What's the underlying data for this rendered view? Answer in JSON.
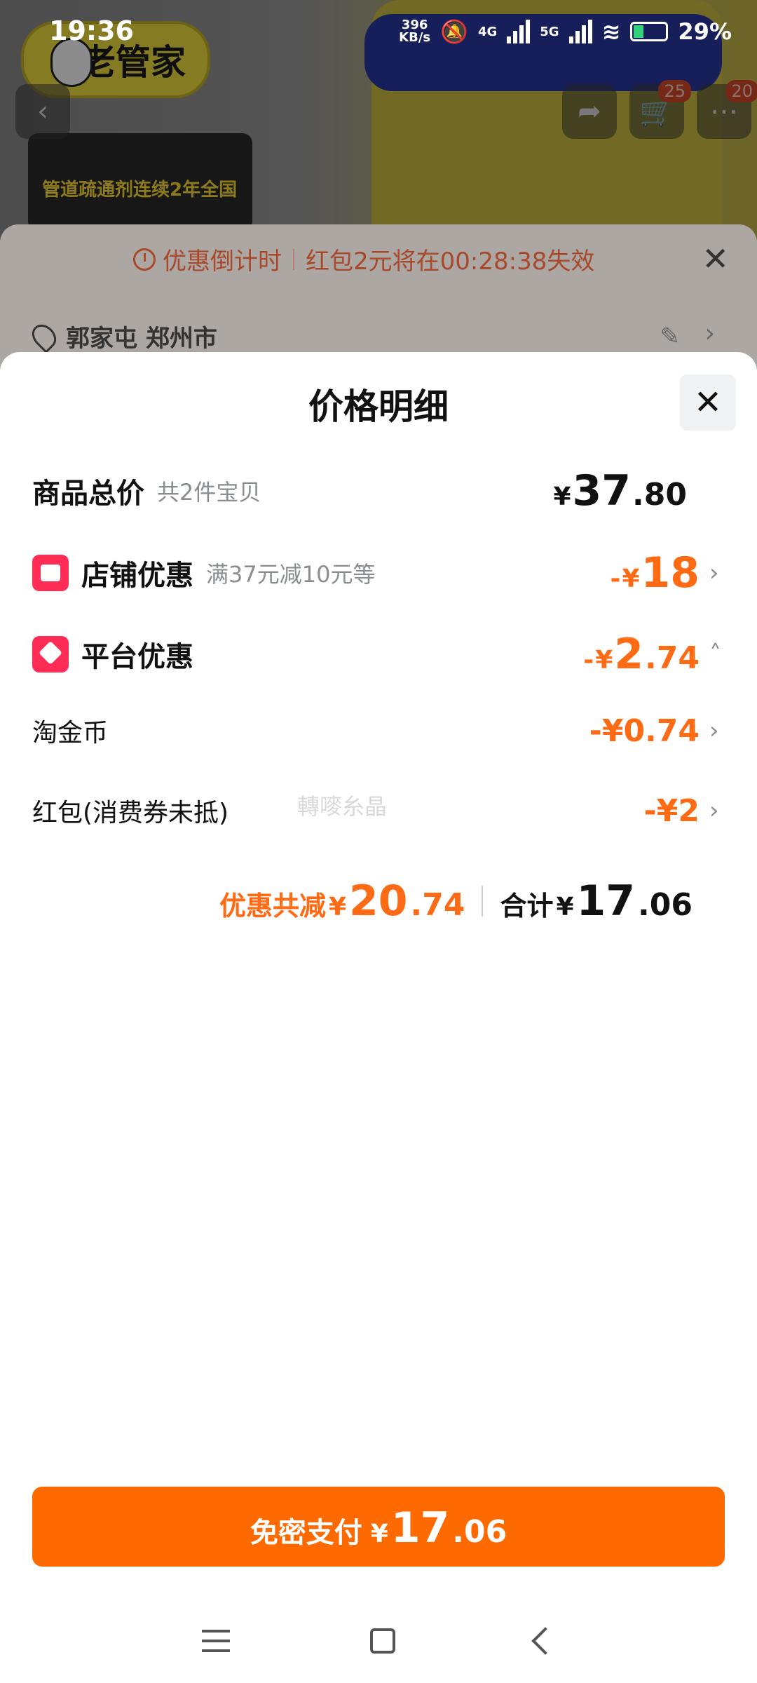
{
  "status_bar": {
    "time": "19:36",
    "speed_value": "396",
    "speed_unit": "KB/s",
    "net1": "4G",
    "net2": "5G",
    "battery": "29%"
  },
  "background": {
    "brand": "老管家",
    "banner_text": "管道疏通剂连续2年全国",
    "cart_badge": "25",
    "more_badge": "20"
  },
  "countdown": {
    "label": "优惠倒计时",
    "message": "红包2元将在00:28:38失效"
  },
  "address": {
    "text": "郭家屯 郑州市"
  },
  "sheet": {
    "title": "价格明细",
    "rows": [
      {
        "label": "商品总价",
        "sub": "共2件宝贝",
        "yen": "¥",
        "int": "37",
        "dec": ".80"
      },
      {
        "label": "店铺优惠",
        "sub": "满37元减10元等",
        "prefix": "-",
        "yen": "¥",
        "int": "18",
        "dec": ""
      },
      {
        "label": "平台优惠",
        "prefix": "-",
        "yen": "¥",
        "int": "2",
        "dec": ".74"
      },
      {
        "label": "淘金币",
        "value": "-¥0.74"
      },
      {
        "label": "红包(消费券未抵)",
        "value": "-¥2"
      }
    ],
    "watermark": "轉嘜糸晶",
    "summary": {
      "discount_label": "优惠共减",
      "discount_yen": "¥",
      "discount_int": "20",
      "discount_dec": ".74",
      "total_label": "合计",
      "total_yen": "¥",
      "total_int": "17",
      "total_dec": ".06"
    },
    "pay_button": {
      "label": "免密支付",
      "yen": "¥",
      "int": "17",
      "dec": ".06"
    }
  },
  "colors": {
    "accent": "#ff6a00",
    "discount": "#ff6a14",
    "icon_red": "#ff2d55"
  }
}
